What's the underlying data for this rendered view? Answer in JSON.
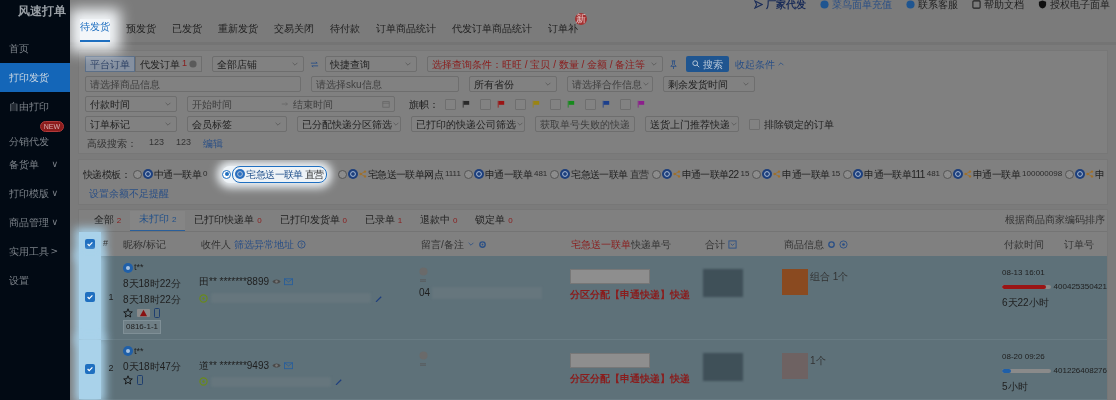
{
  "app_title": "风速打单",
  "sidebar": {
    "items": [
      {
        "label": "首页",
        "selected": false
      },
      {
        "label": "打印发货",
        "selected": true
      },
      {
        "label": "自由打印",
        "selected": false
      },
      {
        "label": "分销代发",
        "selected": false,
        "badge": "NEW"
      },
      {
        "label": "备货单",
        "selected": false,
        "arrow": "∨"
      },
      {
        "label": "打印模版",
        "selected": false,
        "arrow": "∨"
      },
      {
        "label": "商品管理",
        "selected": false,
        "arrow": "∨"
      },
      {
        "label": "实用工具",
        "selected": false,
        "arrow": ">"
      },
      {
        "label": "设置",
        "selected": false
      }
    ]
  },
  "top_links": [
    "厂家代发",
    "菜鸟面单充值",
    "联系客服",
    "帮助文档",
    "授权电子面单"
  ],
  "tabs": [
    {
      "label": "待发货",
      "selected": true
    },
    {
      "label": "预发货",
      "selected": false
    },
    {
      "label": "已发货",
      "selected": false
    },
    {
      "label": "重新发货",
      "selected": false
    },
    {
      "label": "交易关闭",
      "selected": false
    },
    {
      "label": "待付款",
      "selected": false
    },
    {
      "label": "订单商品统计",
      "selected": false
    },
    {
      "label": "代发订单商品统计",
      "selected": false
    },
    {
      "label": "订单补",
      "selected": false,
      "badge": "新"
    }
  ],
  "filters": {
    "source_toggle": [
      {
        "label": "平台订单",
        "selected": true
      },
      {
        "label": "代发订单",
        "count": "1",
        "selected": false
      }
    ],
    "shop": "全部店铺",
    "quick_query": "快捷查询",
    "condition": "选择查询条件：旺旺 / 宝贝 / 数量 / 金额 / 备注等",
    "search_button": "搜索",
    "collapse_link": "收起条件",
    "goods_placeholder": "请选择商品信息",
    "sku_placeholder": "请选择sku信息",
    "province": "所有省份",
    "cooperation_placeholder": "请选择合作信息",
    "remaining_time": "剩余发货时间",
    "pay_time": "付款时间",
    "start_placeholder": "开始时间",
    "end_placeholder": "结束时间",
    "flags_label": "旗帜：",
    "flags": [
      {
        "color": "#2a2a2a",
        "checked": false
      },
      {
        "color": "#9a1414",
        "checked": false
      },
      {
        "color": "#9a8412",
        "checked": false
      },
      {
        "color": "#168a1c",
        "checked": false
      },
      {
        "color": "#1c3f8c",
        "checked": false
      },
      {
        "color": "#8c1e8c",
        "checked": false
      }
    ],
    "order_mark": "订单标记",
    "member_tag": "会员标签",
    "zone_filter": "已分配快递分区筛选",
    "printed_filter": "已打印的快递公司筛选",
    "failed_placeholder": "获取单号失败的快递",
    "door_delivery": "送货上门推荐快递",
    "exclude_locked": {
      "label": "排除锁定的订单",
      "checked": false
    },
    "advanced_label": "高级搜索：",
    "advanced_items": [
      "123",
      "123"
    ],
    "edit_link": "编辑"
  },
  "templates": {
    "label": "快递模板：",
    "items": [
      {
        "name": "中通一联单",
        "note": "0",
        "selected": false,
        "shared": false
      },
      {
        "name": "宅急送一联单",
        "note": "直营",
        "selected": true,
        "shared": false
      },
      {
        "name": "宅急送一联单网点",
        "note": "1111",
        "selected": false,
        "shared": true
      },
      {
        "name": "申通一联单",
        "note": "481",
        "selected": false,
        "shared": false
      },
      {
        "name": "宅急送一联单",
        "note": "直营",
        "selected": false,
        "shared": false
      },
      {
        "name": "申通一联单22",
        "note": "15",
        "selected": false,
        "shared": true
      },
      {
        "name": "申通一联单",
        "note": "15",
        "selected": false,
        "shared": true
      },
      {
        "name": "申通一联单111",
        "note": "481",
        "selected": false,
        "shared": false
      },
      {
        "name": "申通一联单",
        "note": "100000098",
        "selected": false,
        "shared": true
      },
      {
        "name": "申",
        "selected": false,
        "shared": true
      }
    ],
    "reminder_link": "设置余额不足提醒"
  },
  "status_tabs": [
    {
      "label": "全部",
      "count": "2",
      "selected": false
    },
    {
      "label": "未打印",
      "count": "2",
      "selected": true
    },
    {
      "label": "已打印快递单",
      "count": "0",
      "selected": false
    },
    {
      "label": "已打印发货单",
      "count": "0",
      "selected": false
    },
    {
      "label": "已录单",
      "count": "1",
      "selected": false
    },
    {
      "label": "退款中",
      "count": "0",
      "selected": false
    },
    {
      "label": "锁定单",
      "count": "0",
      "selected": false
    }
  ],
  "sort_text": "根据商品商家编码排序",
  "table": {
    "all_checked": true,
    "columns": [
      {
        "label": "#"
      },
      {
        "label": "昵称/标记"
      },
      {
        "label": "收件人",
        "link": "筛选异常地址"
      },
      {
        "label": "留言/备注"
      },
      {
        "accent": "宅急送一联单",
        "label": "快递单号"
      },
      {
        "label": "合计"
      },
      {
        "label": "商品信息"
      },
      {
        "label": "付款时间"
      },
      {
        "label": "订单号"
      }
    ],
    "rows": [
      {
        "checked": true,
        "index": "1",
        "nickname": "t**",
        "times": [
          "8天18时22分",
          "8天18时22分"
        ],
        "warning": true,
        "tag": "0816-1-1",
        "receiver": "田** *******8899",
        "message": "04",
        "allocation": "分区分配【申通快递】快递",
        "goods": "组合 1个",
        "pay_time": "08-13 16:01",
        "level": 0.9,
        "color": "#9a1414",
        "remaining": "6天22小时",
        "order_no": "400425350421"
      },
      {
        "checked": true,
        "index": "2",
        "nickname": "t**",
        "times": [
          "0天18时47分"
        ],
        "warning": false,
        "receiver": "道** *******9493",
        "allocation": "分区分配【申通快递】快递",
        "goods": "1个",
        "pay_time": "08-20 09:26",
        "level": 0.18,
        "color": "#1f5fa8",
        "remaining": "5小时",
        "order_no": "401226408276"
      }
    ]
  }
}
